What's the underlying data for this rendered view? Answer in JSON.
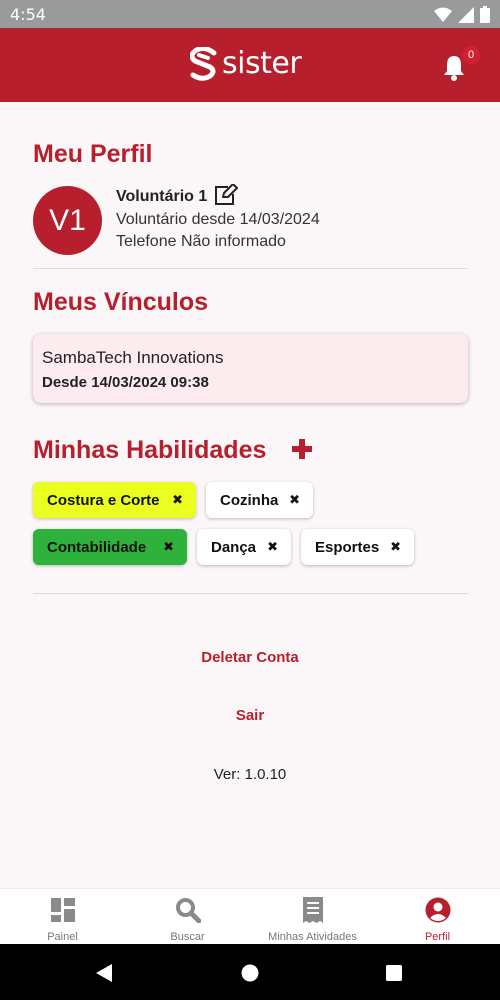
{
  "status_bar": {
    "time": "4:54"
  },
  "header": {
    "logo_text": "sister",
    "notification_count": "0"
  },
  "profile": {
    "title": "Meu Perfil",
    "avatar_initials": "V1",
    "name": "Voluntário 1",
    "since": "Voluntário desde 14/03/2024",
    "phone": "Telefone Não informado"
  },
  "links": {
    "title": "Meus Vínculos",
    "items": [
      {
        "name": "SambaTech Innovations",
        "since": "Desde 14/03/2024 09:38"
      }
    ]
  },
  "skills": {
    "title": "Minhas Habilidades",
    "items": [
      {
        "label": "Costura e Corte",
        "color": "#eaff1f"
      },
      {
        "label": "Cozinha",
        "color": "#ffffff"
      },
      {
        "label": "Contabilidade",
        "color": "#2fb23c"
      },
      {
        "label": "Dança",
        "color": "#ffffff"
      },
      {
        "label": "Esportes",
        "color": "#ffffff"
      }
    ],
    "remove_glyph": "✖"
  },
  "actions": {
    "delete_account": "Deletar Conta",
    "logout": "Sair"
  },
  "version": "Ver: 1.0.10",
  "bottom_nav": [
    {
      "label": "Painel",
      "icon": "dashboard-icon"
    },
    {
      "label": "Buscar",
      "icon": "search-icon"
    },
    {
      "label": "Minhas Atividades",
      "icon": "receipt-icon"
    },
    {
      "label": "Perfil",
      "icon": "user-circle-icon",
      "active": true
    }
  ],
  "colors": {
    "brand": "#b71f2d",
    "background": "#fbf6f8",
    "card": "#fdecef"
  }
}
